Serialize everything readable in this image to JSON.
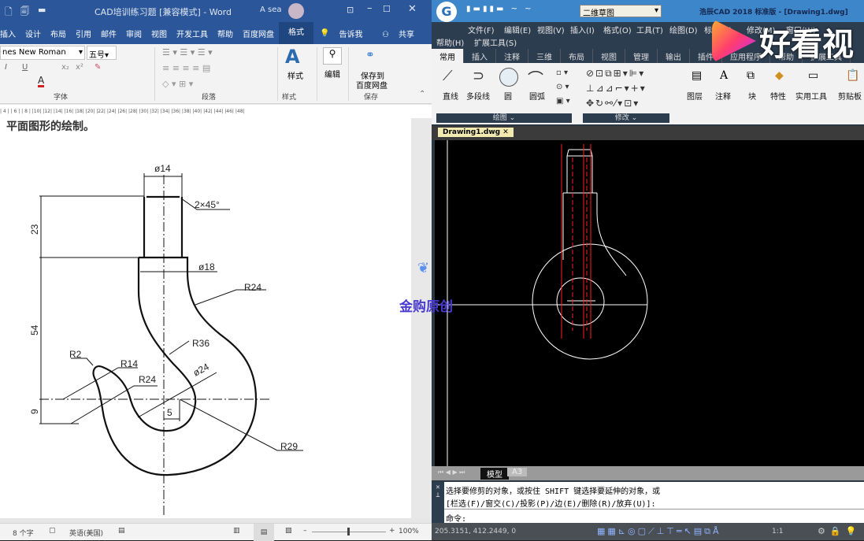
{
  "word": {
    "title": "CAD培训练习题 [兼容模式] - Word",
    "user": "A sea",
    "tabs": [
      "插入",
      "设计",
      "布局",
      "引用",
      "邮件",
      "审阅",
      "视图",
      "开发工具",
      "帮助",
      "百度网盘",
      "格式"
    ],
    "tell_me": "告诉我",
    "share": "共享",
    "font_name": "nes New Roman",
    "font_size": "五号",
    "groups": {
      "font": "字体",
      "paragraph": "段落",
      "styles": "样式",
      "save": "保存"
    },
    "styles_button": "样式",
    "edit_button": "编辑",
    "save_baidu": [
      "保存到",
      "百度网盘"
    ],
    "ruler": "| 4 |   | 6 |   | 8 |   |10|   |12|   |14|   |16|   |18|   |20|   |22|   |24|   |26|   |28|   |30|   |32|   |34|   |36|   |38|   |40|   |42|   |44|   |46|   |48|",
    "doc_text": "平面图形的绘制。",
    "dims": {
      "d14": "ø14",
      "chamfer": "2×45°",
      "d18": "ø18",
      "r24a": "R24",
      "h23": "23",
      "h54": "54",
      "h9": "9",
      "r36": "R36",
      "r2": "R2",
      "r14": "R14",
      "r24b": "R24",
      "d24": "ø24",
      "w5": "5",
      "r29": "R29"
    },
    "status": {
      "words": "8 个字",
      "lang": "英语(美国)",
      "zoom": "100%"
    },
    "zoom_percent": 100
  },
  "cad": {
    "title": "浩辰CAD 2018 标准版 - [Drawing1.dwg]",
    "workspace": "二维草图",
    "menu": [
      "文件(F)",
      "编辑(E)",
      "视图(V)",
      "插入(I)",
      "格式(O)",
      "工具(T)",
      "绘图(D)",
      "标注(N)",
      "修改(M)",
      "窗口(W)",
      "帮助(H)",
      "扩展工具(S)"
    ],
    "tabs": [
      "常用",
      "插入",
      "注释",
      "三维",
      "布局",
      "视图",
      "管理",
      "输出",
      "插件",
      "应用程序",
      "帮助",
      "扩展工具"
    ],
    "draw_tools": [
      "直线",
      "多段线",
      "圆",
      "圆弧"
    ],
    "panels": {
      "draw": "绘图",
      "modify": "修改"
    },
    "big_tools": [
      "图层",
      "注释",
      "块",
      "特性",
      "实用工具",
      "剪贴板"
    ],
    "doc_tab": "Drawing1.dwg",
    "layout_tabs": [
      "模型",
      "A3"
    ],
    "cmd_lines": [
      "选择要修剪的对象，或按住 SHIFT 键选择要延伸的对象，或",
      "[栏选(F)/窗交(C)/投影(P)/边(E)/删除(R)/放弃(U)]:",
      "命令:"
    ],
    "coords": "205.3151, 412.2449, 0",
    "scale": "1:1"
  },
  "watermark": {
    "brand": "好看视",
    "overlay": "金购原创"
  },
  "colors": {
    "word_blue": "#2b579a",
    "cad_red": "#ff2020",
    "canvas": "#000000"
  }
}
